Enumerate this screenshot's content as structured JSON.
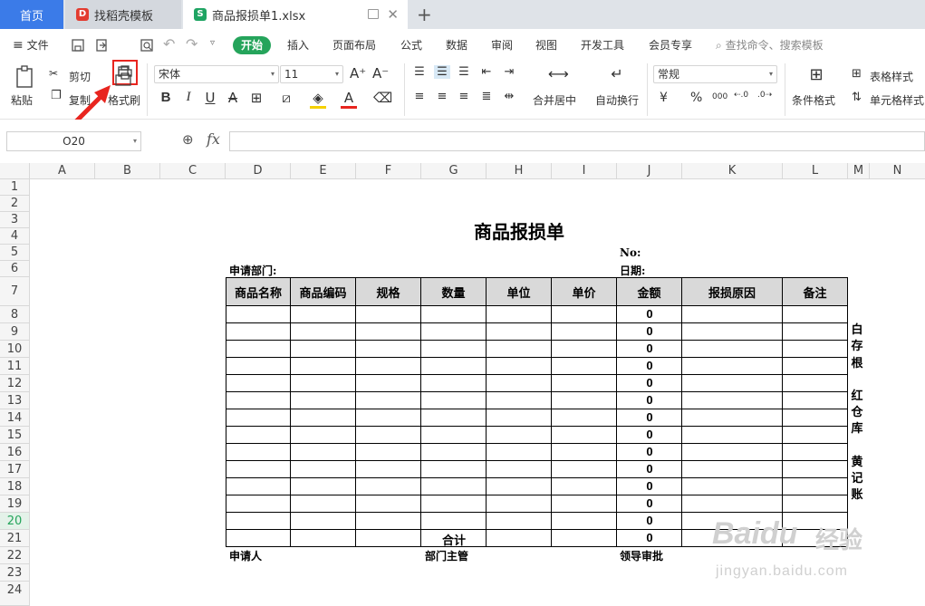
{
  "tabs": {
    "home": "首页",
    "template": "找稻壳模板",
    "document": "商品报损单1.xlsx"
  },
  "ribbon": {
    "file": "文件",
    "tabs": [
      "开始",
      "插入",
      "页面布局",
      "公式",
      "数据",
      "审阅",
      "视图",
      "开发工具",
      "会员专享"
    ],
    "search_placeholder": "查找命令、搜索模板",
    "paste": "粘贴",
    "cut": "剪切",
    "copy": "复制",
    "format_painter": "格式刷",
    "font_name": "宋体",
    "font_size": "11",
    "merge_center": "合并居中",
    "wrap_text": "自动换行",
    "number_format": "常规",
    "conditional_format": "条件格式",
    "table_style": "表格样式",
    "cell_style": "单元格样式",
    "percent": "%",
    "thousands": "000",
    "currency": "¥"
  },
  "formula_bar": {
    "name_box": "O20",
    "fx": "fx",
    "content": ""
  },
  "columns": [
    "A",
    "B",
    "C",
    "D",
    "E",
    "F",
    "G",
    "H",
    "I",
    "J",
    "K",
    "L",
    "M",
    "N"
  ],
  "rows": [
    "1",
    "2",
    "3",
    "4",
    "5",
    "6",
    "7",
    "8",
    "9",
    "10",
    "11",
    "12",
    "13",
    "14",
    "15",
    "16",
    "17",
    "18",
    "19",
    "20",
    "21",
    "22",
    "23",
    "24"
  ],
  "selected_row": "20",
  "sheet": {
    "title": "商品报损单",
    "no_label": "No:",
    "date_label": "日期:",
    "dept_label": "申请部门:",
    "headers": [
      "商品名称",
      "商品编码",
      "规格",
      "数量",
      "单位",
      "单价",
      "金额",
      "报损原因",
      "备注"
    ],
    "amount_values": [
      "0",
      "0",
      "0",
      "0",
      "0",
      "0",
      "0",
      "0",
      "0",
      "0",
      "0",
      "0",
      "0"
    ],
    "total_label": "合计",
    "total_value": "0",
    "footer": {
      "applicant": "申请人",
      "dept_manager": "部门主管",
      "leader_approval": "领导审批"
    },
    "side_note": [
      "白",
      "存",
      "根",
      "",
      "红",
      "仓",
      "库",
      "",
      "黄",
      "记",
      "账"
    ]
  },
  "watermark": {
    "brand": "Baidu",
    "brand_cn": "经验",
    "url": "jingyan.baidu.com"
  },
  "colors": {
    "accent": "#25a45b",
    "home_tab": "#3b7be8",
    "highlight_box": "#e8251f",
    "header_fill": "#d9d9d9"
  }
}
